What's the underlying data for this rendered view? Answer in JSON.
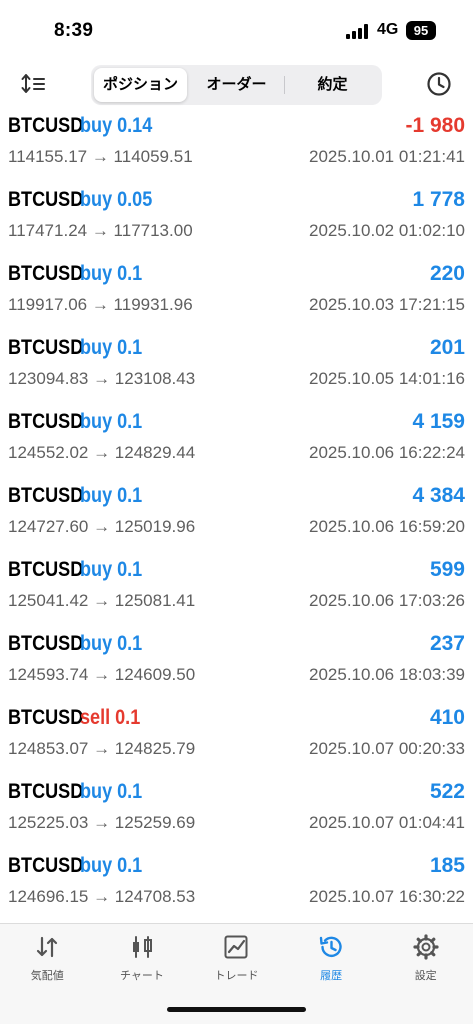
{
  "status_bar": {
    "time": "8:39",
    "network": "4G",
    "battery": "95"
  },
  "toolbar": {
    "sort_icon": "sort-icon",
    "tabs": [
      {
        "label": "ポジション",
        "active": true
      },
      {
        "label": "オーダー",
        "active": false
      },
      {
        "label": "約定",
        "active": false
      }
    ],
    "history_icon": "clock-icon"
  },
  "colors": {
    "buy": "#1e88e5",
    "sell": "#e53a2f",
    "profit_positive": "#1e88e5",
    "profit_negative": "#e53a2f",
    "secondary_text": "#5f5f5f",
    "active_tab": "#1e88e5"
  },
  "deals": [
    {
      "symbol": "BTCUSD",
      "side_label": "buy 0.14",
      "side": "buy",
      "prices": "114155.17 → 114059.51",
      "profit": "-1 980",
      "profit_sign": "negative",
      "time": "2025.10.01 01:21:41"
    },
    {
      "symbol": "BTCUSD",
      "side_label": "buy 0.05",
      "side": "buy",
      "prices": "117471.24 → 117713.00",
      "profit": "1 778",
      "profit_sign": "positive",
      "time": "2025.10.02 01:02:10"
    },
    {
      "symbol": "BTCUSD",
      "side_label": "buy 0.1",
      "side": "buy",
      "prices": "119917.06 → 119931.96",
      "profit": "220",
      "profit_sign": "positive",
      "time": "2025.10.03 17:21:15"
    },
    {
      "symbol": "BTCUSD",
      "side_label": "buy 0.1",
      "side": "buy",
      "prices": "123094.83 → 123108.43",
      "profit": "201",
      "profit_sign": "positive",
      "time": "2025.10.05 14:01:16"
    },
    {
      "symbol": "BTCUSD",
      "side_label": "buy 0.1",
      "side": "buy",
      "prices": "124552.02 → 124829.44",
      "profit": "4 159",
      "profit_sign": "positive",
      "time": "2025.10.06 16:22:24"
    },
    {
      "symbol": "BTCUSD",
      "side_label": "buy 0.1",
      "side": "buy",
      "prices": "124727.60 → 125019.96",
      "profit": "4 384",
      "profit_sign": "positive",
      "time": "2025.10.06 16:59:20"
    },
    {
      "symbol": "BTCUSD",
      "side_label": "buy 0.1",
      "side": "buy",
      "prices": "125041.42 → 125081.41",
      "profit": "599",
      "profit_sign": "positive",
      "time": "2025.10.06 17:03:26"
    },
    {
      "symbol": "BTCUSD",
      "side_label": "buy 0.1",
      "side": "buy",
      "prices": "124593.74 → 124609.50",
      "profit": "237",
      "profit_sign": "positive",
      "time": "2025.10.06 18:03:39"
    },
    {
      "symbol": "BTCUSD",
      "side_label": "sell 0.1",
      "side": "sell",
      "prices": "124853.07 → 124825.79",
      "profit": "410",
      "profit_sign": "positive",
      "time": "2025.10.07 00:20:33"
    },
    {
      "symbol": "BTCUSD",
      "side_label": "buy 0.1",
      "side": "buy",
      "prices": "125225.03 → 125259.69",
      "profit": "522",
      "profit_sign": "positive",
      "time": "2025.10.07 01:04:41"
    },
    {
      "symbol": "BTCUSD",
      "side_label": "buy 0.1",
      "side": "buy",
      "prices": "124696.15 → 124708.53",
      "profit": "185",
      "profit_sign": "positive",
      "time": "2025.10.07 16:30:22"
    }
  ],
  "tab_bar": {
    "tabs": [
      {
        "label": "気配値",
        "icon": "quotes-arrows-icon",
        "active": false
      },
      {
        "label": "チャート",
        "icon": "candlestick-chart-icon",
        "active": false
      },
      {
        "label": "トレード",
        "icon": "trade-chart-icon",
        "active": false
      },
      {
        "label": "履歴",
        "icon": "history-clock-icon",
        "active": true
      },
      {
        "label": "設定",
        "icon": "gear-icon",
        "active": false
      }
    ]
  }
}
